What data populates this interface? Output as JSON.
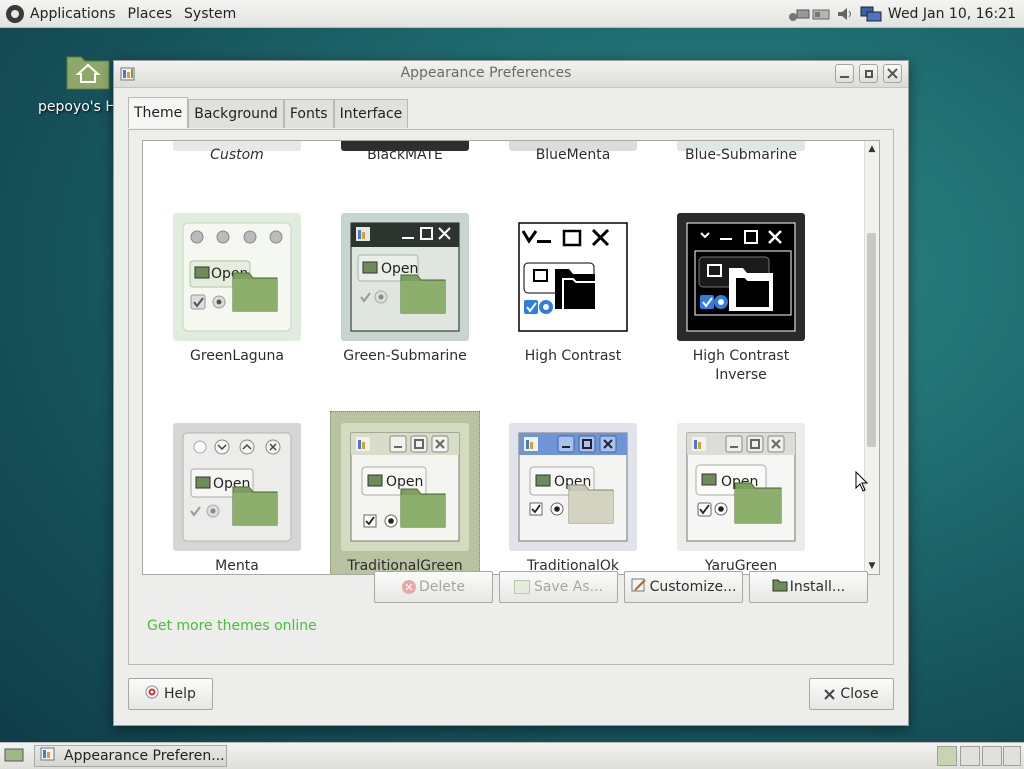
{
  "top_panel": {
    "menus": [
      "Applications",
      "Places",
      "System"
    ],
    "clock": "Wed Jan 10, 16:21"
  },
  "desktop": {
    "home_label": "pepoyo's H"
  },
  "window": {
    "title": "Appearance Preferences",
    "tabs": [
      "Theme",
      "Background",
      "Fonts",
      "Interface"
    ],
    "themes": [
      {
        "name": "Custom",
        "italic": true
      },
      {
        "name": "BlackMATE"
      },
      {
        "name": "BlueMenta"
      },
      {
        "name": "Blue-Submarine"
      },
      {
        "name": "GreenLaguna",
        "open_label": "Open"
      },
      {
        "name": "Green-Submarine",
        "open_label": "Open"
      },
      {
        "name": "High Contrast"
      },
      {
        "name": "High Contrast\nInverse"
      },
      {
        "name": "Menta",
        "open_label": "Open"
      },
      {
        "name": "TraditionalGreen",
        "open_label": "Open",
        "selected": true
      },
      {
        "name": "TraditionalOk",
        "open_label": "Open"
      },
      {
        "name": "YaruGreen",
        "open_label": "Open"
      }
    ],
    "buttons": {
      "delete": "Delete",
      "save_as": "Save As...",
      "customize": "Customize...",
      "install": "Install..."
    },
    "link": "Get more themes online",
    "help": "Help",
    "close": "Close"
  },
  "taskbar": {
    "task_label": "Appearance Preferen..."
  },
  "colors": {
    "link_green": "#48c03b",
    "selection": "#b9c2a1",
    "desktop_teal": "#1f6d71"
  }
}
